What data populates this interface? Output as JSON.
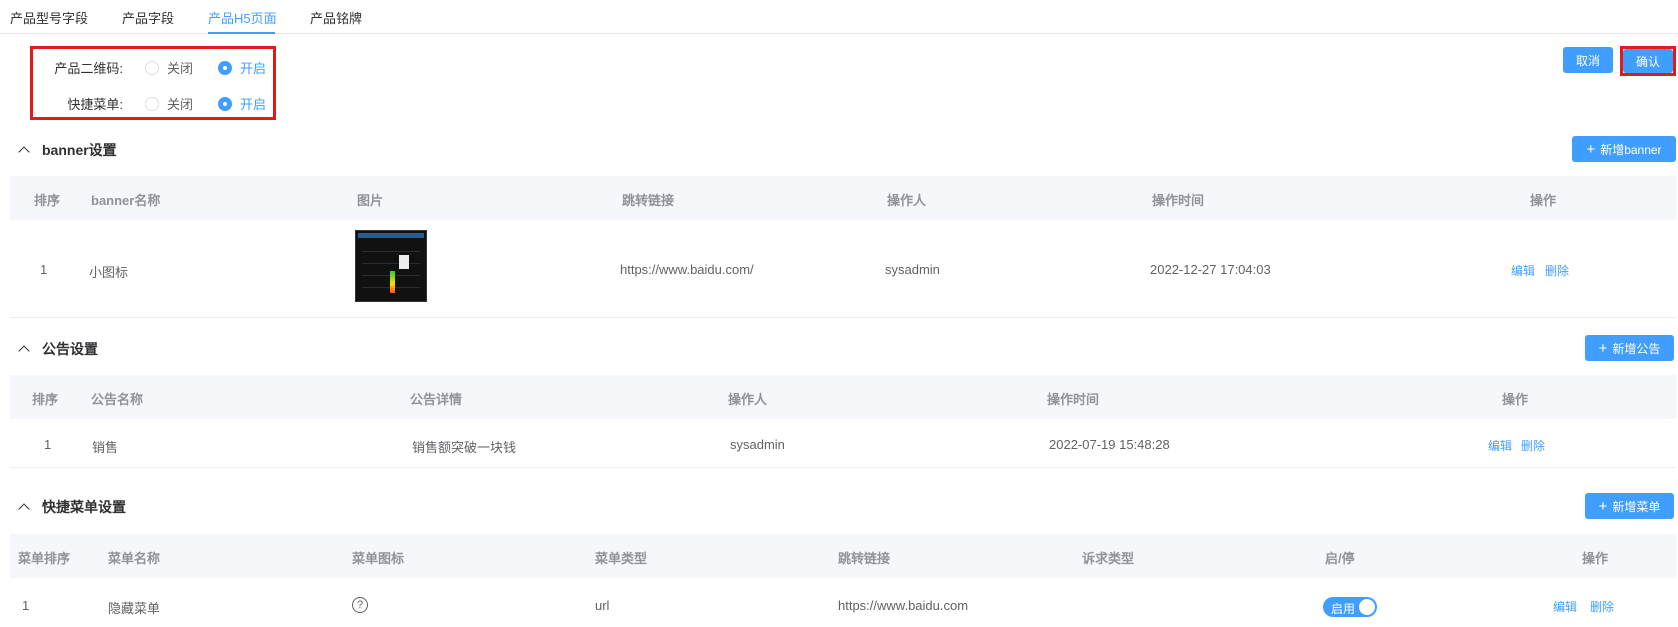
{
  "tabs": [
    "产品型号字段",
    "产品字段",
    "产品H5页面",
    "产品铭牌"
  ],
  "switches": {
    "qrcode": {
      "label": "产品二维码:",
      "off": "关闭",
      "on": "开启",
      "value": "on"
    },
    "quickmenu": {
      "label": "快捷菜单:",
      "off": "关闭",
      "on": "开启",
      "value": "on"
    }
  },
  "actions": {
    "cancel": "取消",
    "confirm": "确认"
  },
  "banner": {
    "title": "banner设置",
    "add_button": "新增banner",
    "columns": [
      "排序",
      "banner名称",
      "图片",
      "跳转链接",
      "操作人",
      "操作时间",
      "操作"
    ],
    "rows": [
      {
        "order": "1",
        "name": "小图标",
        "link": "https://www.baidu.com/",
        "operator": "sysadmin",
        "time": "2022-12-27 17:04:03",
        "edit": "编辑",
        "delete": "删除"
      }
    ]
  },
  "notice": {
    "title": "公告设置",
    "add_button": "新增公告",
    "columns": [
      "排序",
      "公告名称",
      "公告详情",
      "操作人",
      "操作时间",
      "操作"
    ],
    "rows": [
      {
        "order": "1",
        "name": "销售",
        "detail": "销售额突破一块钱",
        "operator": "sysadmin",
        "time": "2022-07-19 15:48:28",
        "edit": "编辑",
        "delete": "删除"
      }
    ]
  },
  "quickmenu": {
    "title": "快捷菜单设置",
    "add_button": "新增菜单",
    "columns": [
      "菜单排序",
      "菜单名称",
      "菜单图标",
      "菜单类型",
      "跳转链接",
      "诉求类型",
      "启/停",
      "操作"
    ],
    "rows": [
      {
        "order": "1",
        "name": "隐藏菜单",
        "icon": "question-circle-icon",
        "type": "url",
        "link": "https://www.baidu.com",
        "appeal": "",
        "status": "启用",
        "edit": "编辑",
        "delete": "删除"
      }
    ]
  },
  "colors": {
    "accent": "#409eff",
    "highlight": "#e11b1b"
  }
}
